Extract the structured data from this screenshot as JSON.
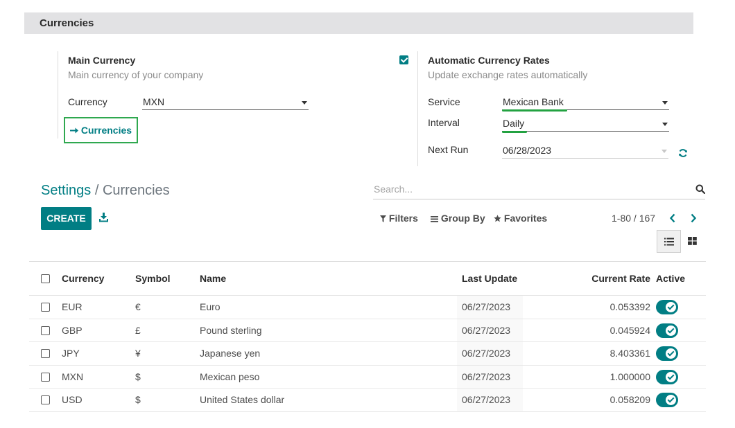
{
  "section": {
    "title": "Currencies"
  },
  "main_currency": {
    "title": "Main Currency",
    "subtitle": "Main currency of your company",
    "currency_label": "Currency",
    "currency_value": "MXN",
    "link_label": "Currencies"
  },
  "auto_rates": {
    "enabled": true,
    "title": "Automatic Currency Rates",
    "subtitle": "Update exchange rates automatically",
    "service_label": "Service",
    "service_value": "Mexican Bank",
    "interval_label": "Interval",
    "interval_value": "Daily",
    "next_run_label": "Next Run",
    "next_run_value": "06/28/2023"
  },
  "breadcrumb": {
    "parent": "Settings",
    "separator": " / ",
    "current": "Currencies"
  },
  "search": {
    "placeholder": "Search..."
  },
  "toolbar": {
    "create_label": "CREATE"
  },
  "filters": {
    "filters_label": "Filters",
    "group_by_label": "Group By",
    "favorites_label": "Favorites"
  },
  "pager": {
    "text": "1-80 / 167"
  },
  "table": {
    "columns": {
      "currency": "Currency",
      "symbol": "Symbol",
      "name": "Name",
      "last_update": "Last Update",
      "rate": "Current Rate",
      "active": "Active"
    },
    "rows": [
      {
        "currency": "EUR",
        "symbol": "€",
        "name": "Euro",
        "last_update": "06/27/2023",
        "rate": "0.053392",
        "active": true
      },
      {
        "currency": "GBP",
        "symbol": "£",
        "name": "Pound sterling",
        "last_update": "06/27/2023",
        "rate": "0.045924",
        "active": true
      },
      {
        "currency": "JPY",
        "symbol": "¥",
        "name": "Japanese yen",
        "last_update": "06/27/2023",
        "rate": "8.403361",
        "active": true
      },
      {
        "currency": "MXN",
        "symbol": "$",
        "name": "Mexican peso",
        "last_update": "06/27/2023",
        "rate": "1.000000",
        "active": true
      },
      {
        "currency": "USD",
        "symbol": "$",
        "name": "United States dollar",
        "last_update": "06/27/2023",
        "rate": "0.058209",
        "active": true
      }
    ]
  },
  "colors": {
    "primary": "#017e84",
    "highlight": "#23a241"
  }
}
